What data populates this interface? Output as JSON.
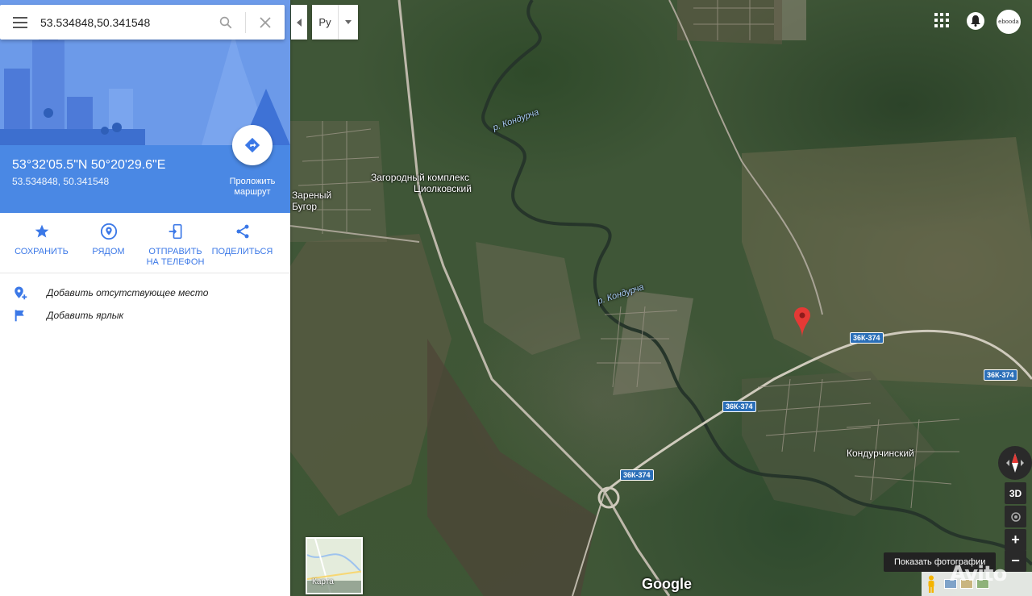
{
  "search": {
    "value": "53.534848,50.341548"
  },
  "place": {
    "dms": "53°32'05.5\"N 50°20'29.6\"E",
    "decimal": "53.534848, 50.341548"
  },
  "route": {
    "label_line1": "Проложить",
    "label_line2": "маршрут"
  },
  "actions": [
    {
      "label": "СОХРАНИТЬ",
      "icon": "star-icon"
    },
    {
      "label": "РЯДОМ",
      "icon": "nearby-pin-icon"
    },
    {
      "label_line1": "ОТПРАВИТЬ",
      "label_line2": "НА ТЕЛЕФОН",
      "icon": "send-to-phone-icon"
    },
    {
      "label": "ПОДЕЛИТЬСЯ",
      "icon": "share-icon"
    }
  ],
  "list": [
    {
      "label": "Добавить отсутствующее место",
      "icon": "add-place-icon"
    },
    {
      "label": "Добавить ярлык",
      "icon": "flag-icon"
    }
  ],
  "map": {
    "language": "Ру",
    "labels": {
      "river1": "р. Кондурча",
      "river2": "р. Кондурча",
      "complex_line1": "Загородный комплекс",
      "complex_line2": "Циолковский",
      "village1_line1": "Зареный",
      "village1_line2": "Бугор",
      "village2": "Кондурчинский"
    },
    "roads": [
      "36К-374",
      "36К-374",
      "36К-374",
      "36К-374"
    ],
    "minimap_label": "Карта",
    "logo": "Google",
    "tooltip": "Показать фотографии",
    "btn_3d": "3D",
    "zoom_in": "+",
    "zoom_out": "−",
    "avatar_text": "ebooda",
    "watermark": "Avito"
  },
  "colors": {
    "accent": "#3b78e7",
    "coords_bg": "#4a88e4",
    "pin": "#e53935"
  }
}
